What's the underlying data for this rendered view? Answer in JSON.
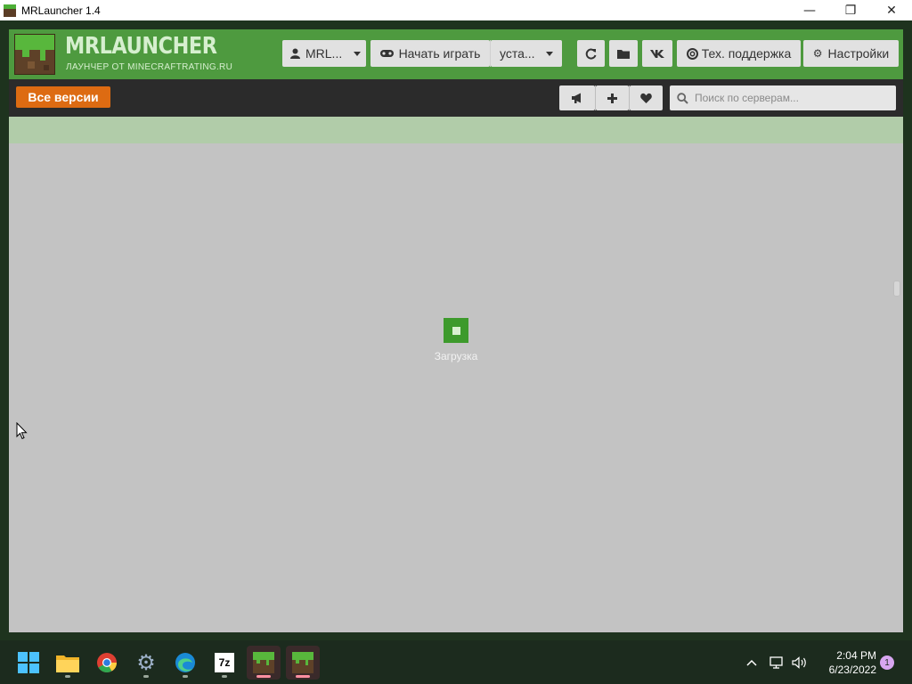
{
  "window": {
    "title": "MRLauncher 1.4",
    "controls": {
      "minimize": "—",
      "maximize": "❐",
      "close": "✕"
    }
  },
  "header": {
    "logo_title": "MRLAUNCHER",
    "logo_subtitle": "ЛАУНЧЕР ОТ MINECRAFTRATING.RU",
    "account_label": "MRL...",
    "play_label": "Начать играть",
    "install_label": "уста...",
    "support_label": "Тех. поддержка",
    "settings_label": "Настройки",
    "icons": [
      "user-icon",
      "gamepad-icon",
      "refresh-icon",
      "folder-icon",
      "vk-icon",
      "lifebuoy-icon",
      "gear-icon"
    ]
  },
  "toolbar": {
    "versions_label": "Все версии",
    "search_placeholder": "Поиск по серверам...",
    "icons": [
      "megaphone-icon",
      "plus-icon",
      "heart-icon",
      "search-icon"
    ]
  },
  "content": {
    "loading_text": "Загрузка"
  },
  "taskbar": {
    "apps": [
      "start-icon",
      "file-explorer-icon",
      "chrome-icon",
      "settings-icon",
      "edge-icon",
      "7zip-icon",
      "mrlauncher-icon",
      "mrlauncher-icon"
    ],
    "sevenzip_label": "7z",
    "time": "2:04 PM",
    "date": "6/23/2022",
    "notification_count": "1"
  },
  "colors": {
    "header_green": "#4e9a3f",
    "accent_orange": "#dd6b12",
    "content_gray": "#c3c3c3",
    "loader_green": "#3d9a2c"
  }
}
